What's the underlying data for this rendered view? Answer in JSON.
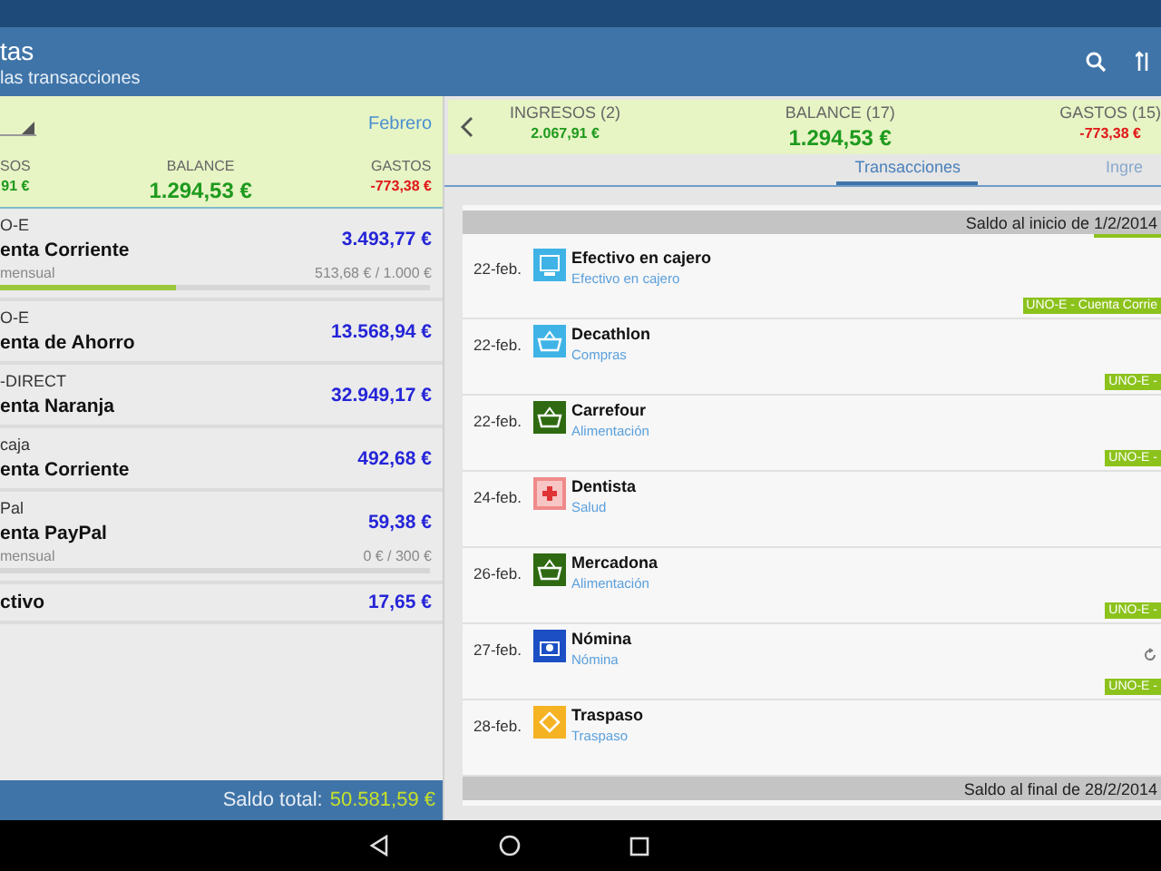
{
  "app_bar": {
    "title": "tas",
    "subtitle": "las transacciones"
  },
  "left_summary": {
    "period_link": "Febrero",
    "columns": [
      {
        "label": "SOS",
        "value": "91 €",
        "color": "#1e9a1e"
      },
      {
        "label": "BALANCE",
        "value": "1.294,53 €",
        "color": "#1e9a1e"
      },
      {
        "label": "GASTOS",
        "value": "-773,38 €",
        "color": "#e01818"
      }
    ]
  },
  "accounts": [
    {
      "bank": "O-E",
      "name": "enta Corriente",
      "amount": "3.493,77 €",
      "budget": {
        "label": "mensual",
        "reading": "513,68 € / 1.000 €",
        "level": 0.41
      }
    },
    {
      "bank": "O-E",
      "name": "enta de Ahorro",
      "amount": "13.568,94 €"
    },
    {
      "bank": "-DIRECT",
      "name": "enta Naranja",
      "amount": "32.949,17 €"
    },
    {
      "bank": "caja",
      "name": "enta Corriente",
      "amount": "492,68 €"
    },
    {
      "bank": "Pal",
      "name": "enta PayPal",
      "amount": "59,38 €",
      "budget": {
        "label": "mensual",
        "reading": "0 € / 300 €",
        "level": 0
      }
    },
    {
      "name": "ctivo",
      "amount": "17,65 €"
    }
  ],
  "total": {
    "label": "Saldo total:",
    "value": "50.581,59 €"
  },
  "right_summary": [
    {
      "label": "INGRESOS (2)",
      "value": "2.067,91 €",
      "color": "#1e9a1e"
    },
    {
      "label": "BALANCE (17)",
      "value": "1.294,53 €",
      "color": "#1e9a1e"
    },
    {
      "label": "GASTOS (15)",
      "value": "-773,38 €",
      "color": "#e01818"
    }
  ],
  "tabs": [
    {
      "label": "Transacciones",
      "selected": true
    },
    {
      "label": "Ingre",
      "selected": false
    }
  ],
  "opening_balance": "Saldo al inicio de 1/2/2014",
  "transactions": [
    {
      "date": "22-feb.",
      "title": "Efectivo en cajero",
      "category": "Efectivo en cajero",
      "kind": "atm",
      "color": "#3fb3e6",
      "account": "UNO-E - Cuenta Corrie",
      "recurring": false
    },
    {
      "date": "22-feb.",
      "title": "Decathlon",
      "category": "Compras",
      "kind": "basket",
      "color": "#3fb3e6",
      "account": "UNO-E -",
      "recurring": false
    },
    {
      "date": "22-feb.",
      "title": "Carrefour",
      "category": "Alimentación",
      "kind": "basket",
      "color": "#2f6a12",
      "account": "UNO-E -",
      "recurring": false
    },
    {
      "date": "24-feb.",
      "title": "Dentista",
      "category": "Salud",
      "kind": "health",
      "color": "#f08a8a",
      "recurring": false
    },
    {
      "date": "26-feb.",
      "title": "Mercadona",
      "category": "Alimentación",
      "kind": "basket",
      "color": "#2f6a12",
      "account": "UNO-E -",
      "recurring": false
    },
    {
      "date": "27-feb.",
      "title": "Nómina",
      "category": "Nómina",
      "kind": "salary",
      "color": "#1c4fc4",
      "account": "UNO-E -",
      "recurring": true
    },
    {
      "date": "28-feb.",
      "title": "Traspaso",
      "category": "Traspaso",
      "kind": "transfer",
      "color": "#f5b324",
      "recurring": false
    }
  ],
  "closing_balance": "Saldo al final de 28/2/2014"
}
